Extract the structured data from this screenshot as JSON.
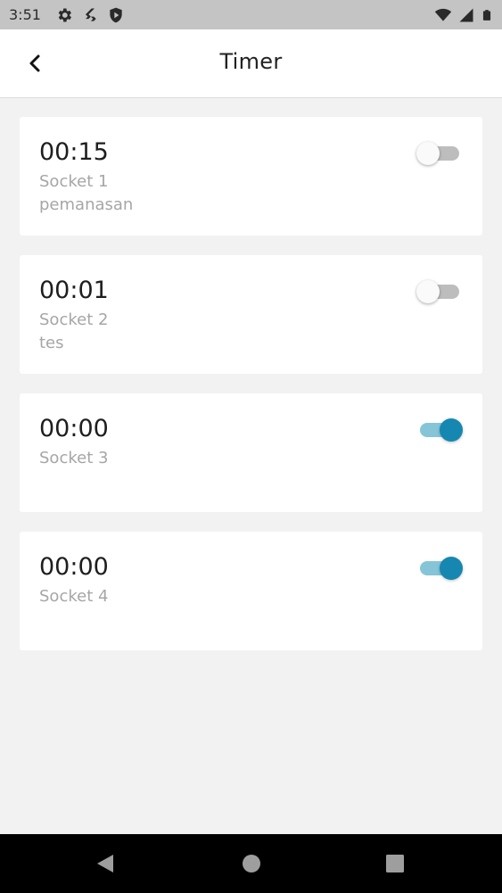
{
  "status_bar": {
    "time": "3:51",
    "left_icons": [
      "gear-icon",
      "flutter-icon",
      "shield-icon"
    ],
    "right_icons": [
      "wifi-icon",
      "signal-icon",
      "battery-icon"
    ]
  },
  "header": {
    "title": "Timer",
    "back_icon": "chevron-left-icon"
  },
  "timers": [
    {
      "time": "00:15",
      "socket": "Socket 1",
      "note": "pemanasan",
      "enabled": false
    },
    {
      "time": "00:01",
      "socket": "Socket 2",
      "note": "tes",
      "enabled": false
    },
    {
      "time": "00:00",
      "socket": "Socket 3",
      "note": "",
      "enabled": true
    },
    {
      "time": "00:00",
      "socket": "Socket 4",
      "note": "",
      "enabled": true
    }
  ],
  "colors": {
    "accent": "#1687b0",
    "accent_track": "#86c5d8",
    "background": "#f2f2f2",
    "card": "#ffffff",
    "secondary_text": "#a6a6a6"
  },
  "nav_bar": {
    "icons": [
      "back-triangle-icon",
      "home-circle-icon",
      "recents-square-icon"
    ]
  }
}
